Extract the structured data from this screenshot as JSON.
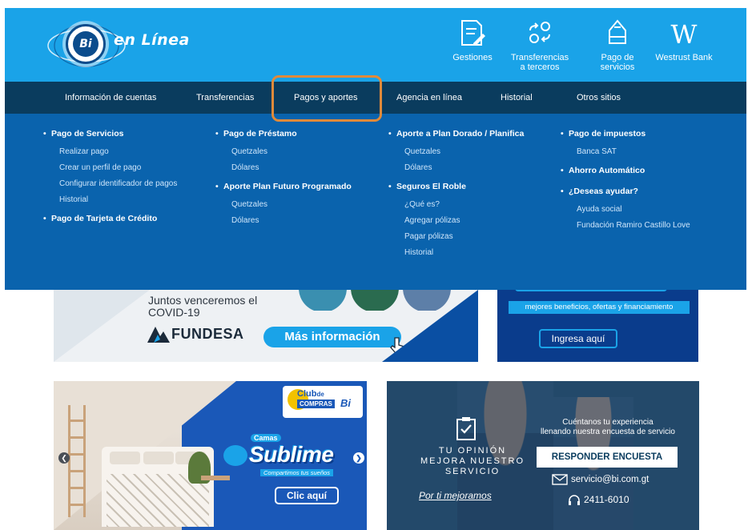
{
  "brand": {
    "logo_badge": "Bi",
    "logo_text": "en Línea"
  },
  "quick_links": [
    {
      "label": "Gestiones",
      "icon": "form-pencil-icon"
    },
    {
      "label": "Transferencias a terceros",
      "icon": "transfer-arrows-icon"
    },
    {
      "label": "Pago de servicios",
      "icon": "hand-money-icon"
    },
    {
      "label": "Westrust Bank",
      "icon": "westrust-w-icon"
    }
  ],
  "nav": {
    "items": [
      "Información de cuentas",
      "Transferencias",
      "Pagos y aportes",
      "Agencia en línea",
      "Historial",
      "Otros sitios"
    ],
    "active": "Pagos y aportes"
  },
  "mega_menu": {
    "col1": {
      "h1": "Pago de Servicios",
      "h1_items": [
        "Realizar pago",
        "Crear un perfil de pago",
        "Configurar identificador de pagos",
        "Historial"
      ],
      "h2": "Pago de Tarjeta de Crédito"
    },
    "col2": {
      "h1": "Pago de Préstamo",
      "h1_items": [
        "Quetzales",
        "Dólares"
      ],
      "h2": "Aporte Plan Futuro Programado",
      "h2_items": [
        "Quetzales",
        "Dólares"
      ]
    },
    "col3": {
      "h1": "Aporte a Plan Dorado / Planifica",
      "h1_items": [
        "Quetzales",
        "Dólares"
      ],
      "h2": "Seguros El Roble",
      "h2_items": [
        "¿Qué es?",
        "Agregar pólizas",
        "Pagar pólizas",
        "Historial"
      ]
    },
    "col4": {
      "h1": "Pago de impuestos",
      "h1_items": [
        "Banca SAT"
      ],
      "h2": "Ahorro Automático",
      "h3": "¿Deseas ayudar?",
      "h3_items": [
        "Ayuda social",
        "Fundación Ramiro Castillo Love"
      ]
    }
  },
  "banner_covid": {
    "text_line1": "Juntos venceremos el",
    "text_line2": "COVID-19",
    "org": "FUNDESA",
    "button": "Más información"
  },
  "banner_enlinea": {
    "tagline": "mejores beneficios, ofertas y financiamiento",
    "button": "Ingresa aquí"
  },
  "banner_club": {
    "club_top": "Club",
    "club_de": "de",
    "club_compras": "COMPRAS",
    "club_bi": "Bi",
    "camas": "Camas",
    "product": "Sublime",
    "slogan": "Compartimos tus sueños",
    "button": "Clic aquí"
  },
  "banner_survey": {
    "headline_1": "TU OPINIÓN",
    "headline_2": "MEJORA NUESTRO",
    "headline_3": "SERVICIO",
    "tagline": "Por ti mejoramos",
    "invite_1": "Cuéntanos tu experiencia",
    "invite_2": "llenando nuestra encuesta de servicio",
    "button_bold": "RESPONDER",
    "button_rest": "ENCUESTA",
    "email": "servicio@bi.com.gt",
    "phone": "2411-6010"
  },
  "colors": {
    "topbar": "#1aa3e8",
    "navbar": "#0a3c5e",
    "megamenu": "#0a63ad",
    "highlight": "#e08a3a"
  }
}
